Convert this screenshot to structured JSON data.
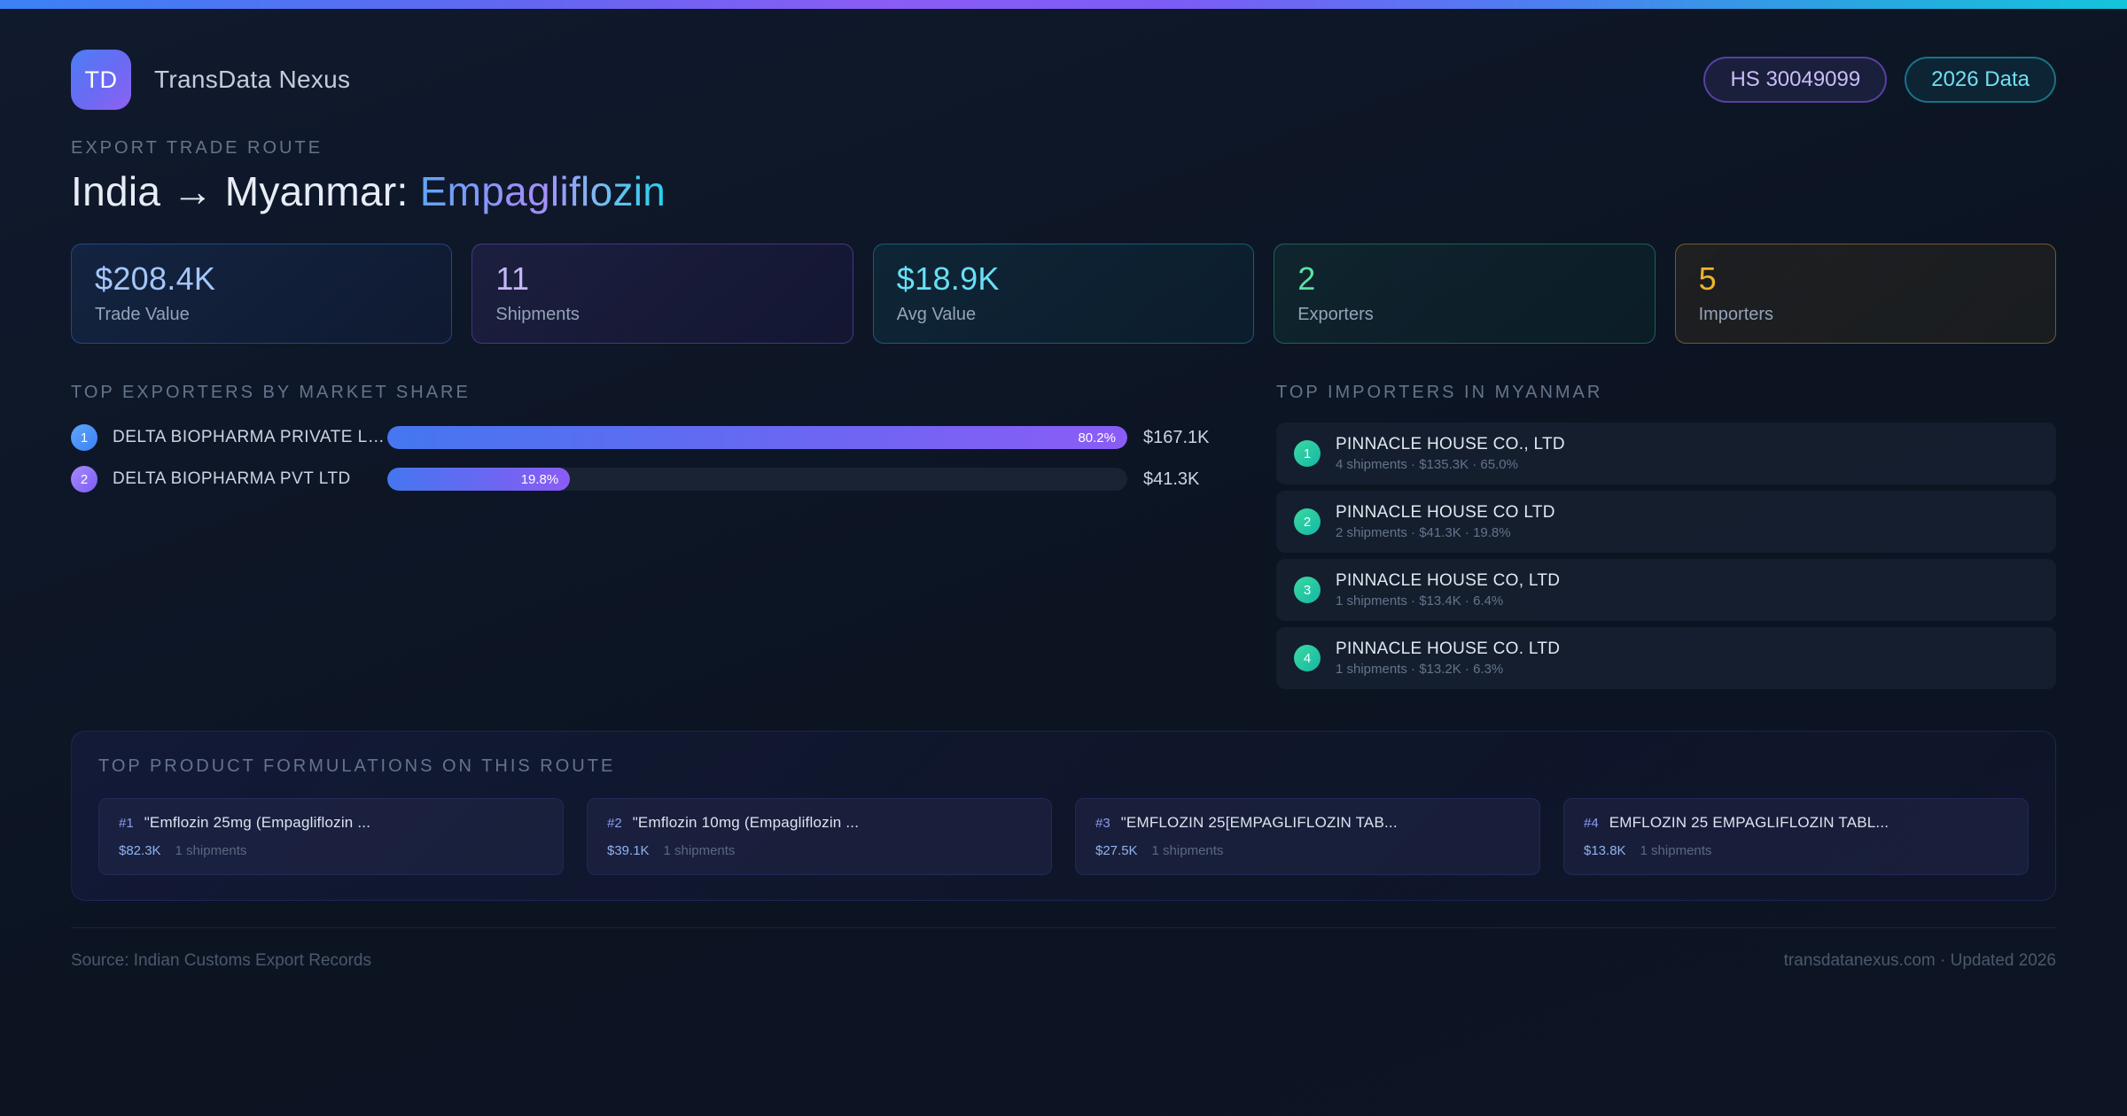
{
  "accent_colors": {
    "blue": "#3b82f6",
    "purple": "#8b5cf6",
    "cyan": "#22d3ee",
    "green": "#34d399",
    "amber": "#f0b429",
    "stripe_cyan": "#14c4dc"
  },
  "brand": {
    "initials": "TD",
    "name": "TransData Nexus"
  },
  "badges": {
    "hs_code": "HS 30049099",
    "year": "2026 Data"
  },
  "header": {
    "eyebrow": "EXPORT TRADE ROUTE",
    "title_route": "India → Myanmar: ",
    "title_product": "Empagliflozin"
  },
  "stats": [
    {
      "value": "$208.4K",
      "label": "Trade Value"
    },
    {
      "value": "11",
      "label": "Shipments"
    },
    {
      "value": "$18.9K",
      "label": "Avg Value"
    },
    {
      "value": "2",
      "label": "Exporters"
    },
    {
      "value": "5",
      "label": "Importers"
    }
  ],
  "exporters": {
    "heading": "TOP EXPORTERS BY MARKET SHARE",
    "rows": [
      {
        "rank": "1",
        "name": "DELTA BIOPHARMA PRIVATE LI...",
        "share_label": "80.2%",
        "bar_width_pct": 100,
        "value": "$167.1K"
      },
      {
        "rank": "2",
        "name": "DELTA BIOPHARMA PVT LTD",
        "share_label": "19.8%",
        "bar_width_pct": 24.7,
        "value": "$41.3K"
      }
    ]
  },
  "importers": {
    "heading": "TOP IMPORTERS IN MYANMAR",
    "rows": [
      {
        "rank": "1",
        "name": "PINNACLE HOUSE CO., LTD",
        "details": "4 shipments · $135.3K · 65.0%"
      },
      {
        "rank": "2",
        "name": "PINNACLE HOUSE CO LTD",
        "details": "2 shipments · $41.3K · 19.8%"
      },
      {
        "rank": "3",
        "name": "PINNACLE HOUSE CO, LTD",
        "details": "1 shipments · $13.4K · 6.4%"
      },
      {
        "rank": "4",
        "name": "PINNACLE HOUSE CO. LTD",
        "details": "1 shipments · $13.2K · 6.3%"
      }
    ]
  },
  "formulations": {
    "heading": "TOP PRODUCT FORMULATIONS ON THIS ROUTE",
    "cards": [
      {
        "rank_label": "#1",
        "name": "\"Emflozin 25mg (Empagliflozin ...",
        "value": "$82.3K",
        "shipments": "1 shipments"
      },
      {
        "rank_label": "#2",
        "name": "\"Emflozin 10mg (Empagliflozin ...",
        "value": "$39.1K",
        "shipments": "1 shipments"
      },
      {
        "rank_label": "#3",
        "name": "\"EMFLOZIN 25[EMPAGLIFLOZIN TAB...",
        "value": "$27.5K",
        "shipments": "1 shipments"
      },
      {
        "rank_label": "#4",
        "name": "EMFLOZIN 25 EMPAGLIFLOZIN TABL...",
        "value": "$13.8K",
        "shipments": "1 shipments"
      }
    ]
  },
  "footer": {
    "source": "Source: Indian Customs Export Records",
    "meta": "transdatanexus.com · Updated 2026"
  }
}
